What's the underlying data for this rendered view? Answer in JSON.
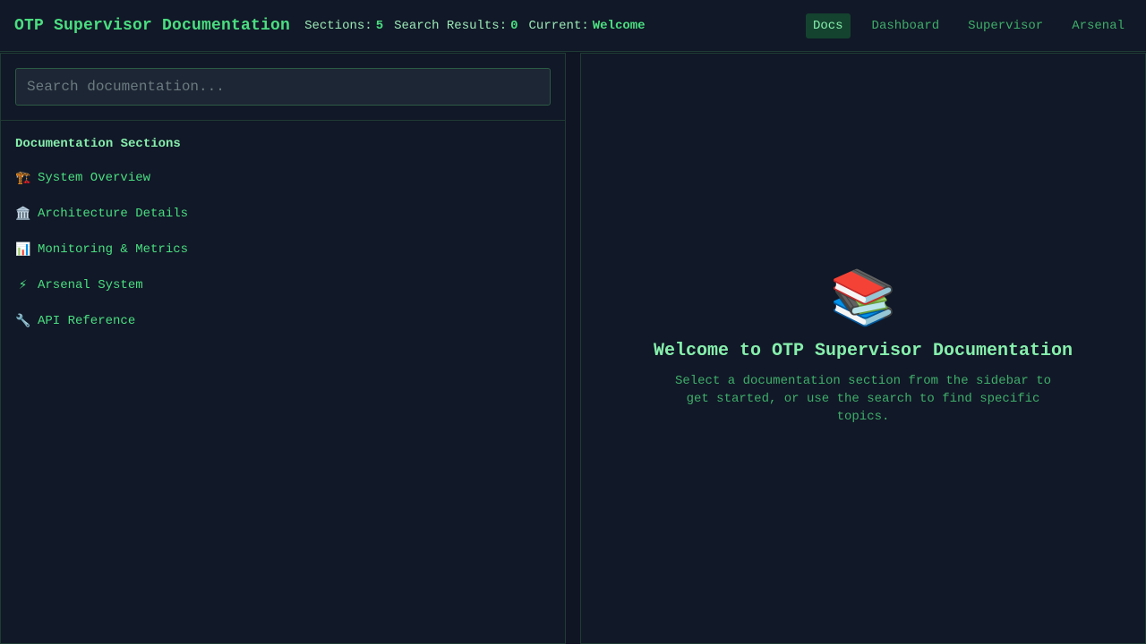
{
  "header": {
    "title": "OTP Supervisor Documentation",
    "stats": [
      {
        "label": "Sections:",
        "value": "5"
      },
      {
        "label": "Search Results:",
        "value": "0"
      },
      {
        "label": "Current:",
        "value": "Welcome"
      }
    ],
    "nav": [
      {
        "label": "Docs",
        "active": true
      },
      {
        "label": "Dashboard",
        "active": false
      },
      {
        "label": "Supervisor",
        "active": false
      },
      {
        "label": "Arsenal",
        "active": false
      }
    ]
  },
  "sidebar": {
    "search_placeholder": "Search documentation...",
    "search_value": "",
    "sections_title": "Documentation Sections",
    "items": [
      {
        "icon": "🏗️",
        "icon_name": "building-construction-icon",
        "label": "System Overview"
      },
      {
        "icon": "🏛️",
        "icon_name": "classical-building-icon",
        "label": "Architecture Details"
      },
      {
        "icon": "📊",
        "icon_name": "bar-chart-icon",
        "label": "Monitoring & Metrics"
      },
      {
        "icon": "⚡",
        "icon_name": "lightning-icon",
        "label": "Arsenal System"
      },
      {
        "icon": "🔧",
        "icon_name": "wrench-icon",
        "label": "API Reference"
      }
    ]
  },
  "main": {
    "icon": "📚",
    "icon_name": "books-icon",
    "title": "Welcome to OTP Supervisor Documentation",
    "text": "Select a documentation section from the sidebar to get started, or use the search to find specific topics."
  },
  "colors": {
    "background": "#0f1523",
    "panel": "#111827",
    "accent": "#4ade80",
    "accent_light": "#86efac",
    "active_nav_bg": "#14432f"
  }
}
